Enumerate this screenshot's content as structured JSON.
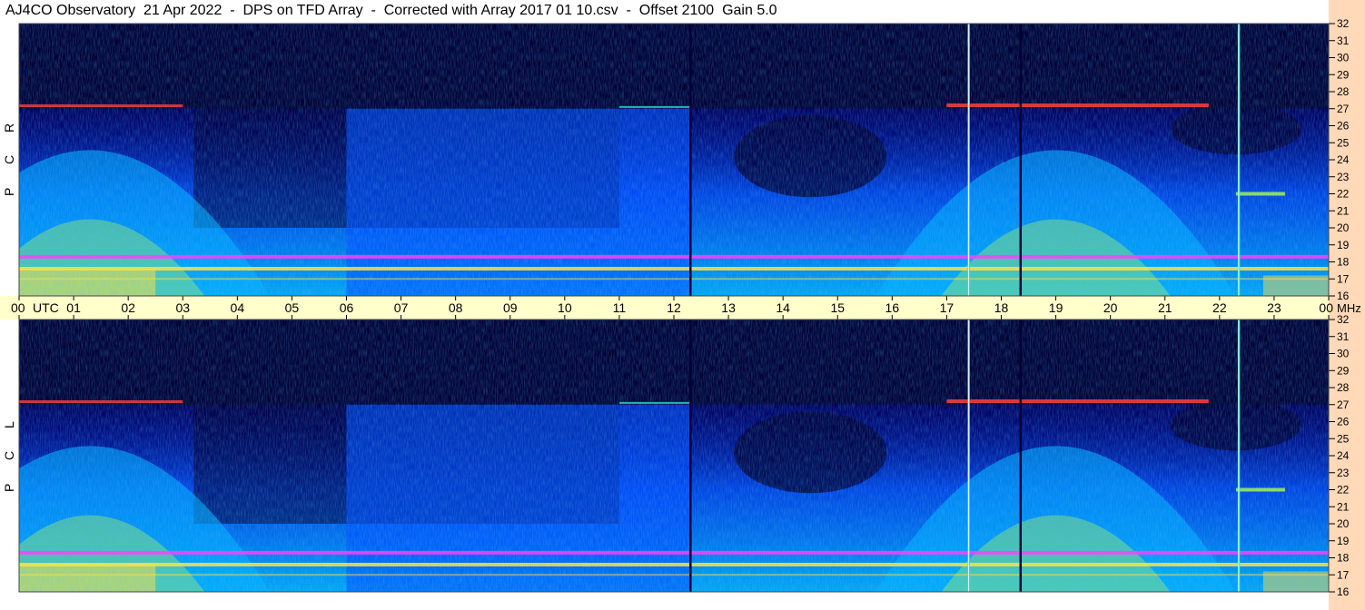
{
  "header": {
    "title": "AJ4CO Observatory  21 Apr 2022  -  DPS on TFD Array  -  Corrected with Array 2017 01 10.csv  -  Offset 2100  Gain 5.0"
  },
  "colors": {
    "background_dark": "#00003a",
    "band_strip": "#ffffcc",
    "freq_strip": "#ffd9b8",
    "colormap": [
      "#000033",
      "#0000a0",
      "#0050ff",
      "#00b0ff",
      "#30e0d0",
      "#a0f060",
      "#ffe040",
      "#ff4040",
      "#ff40ff"
    ]
  },
  "chart_data": {
    "type": "heatmap",
    "title": "AJ4CO Observatory  21 Apr 2022  -  DPS on TFD Array  -  Corrected with Array 2017 01 10.csv  -  Offset 2100  Gain 5.0",
    "x_axis": {
      "unit_label": "UTC",
      "range": [
        0,
        24
      ],
      "tick_labels": [
        "00",
        "01",
        "02",
        "03",
        "04",
        "05",
        "06",
        "07",
        "08",
        "09",
        "10",
        "11",
        "12",
        "13",
        "14",
        "15",
        "16",
        "17",
        "18",
        "19",
        "20",
        "21",
        "22",
        "23",
        "00"
      ]
    },
    "y_axis": {
      "unit_label": "MHz",
      "range": [
        16,
        32
      ],
      "tick_labels": [
        "32",
        "31",
        "30",
        "29",
        "28",
        "27",
        "26",
        "25",
        "24",
        "23",
        "22",
        "21",
        "20",
        "19",
        "18",
        "17",
        "16"
      ]
    },
    "panels": [
      {
        "label": "RCP",
        "letters": [
          "R",
          "C",
          "P"
        ]
      },
      {
        "label": "LCP",
        "letters": [
          "L",
          "C",
          "P"
        ]
      }
    ],
    "features": {
      "vertical_lines_utc": [
        12.3,
        17.4,
        18.35,
        22.35
      ],
      "intense_bands_mhz": [
        27.2,
        17.6,
        18.3,
        22.0
      ],
      "galactic_arch_peaks_utc": [
        1.3,
        19.0
      ]
    }
  }
}
